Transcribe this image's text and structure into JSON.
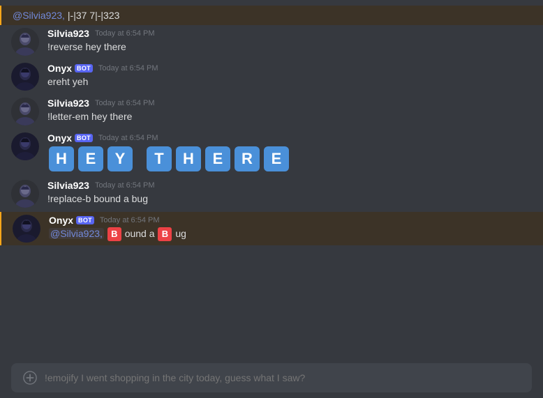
{
  "colors": {
    "background": "#36393f",
    "messageHover": "#32353b",
    "highlighted": "#3c3327",
    "highlightBorder": "#faa61a",
    "botBadge": "#5865f2",
    "mention": "#7289da",
    "letterBox": "#4a90d9",
    "highlightB": "#ed4245",
    "inputBg": "#40444b",
    "timestamp": "#72767d",
    "textColor": "#dcddde"
  },
  "topBar": {
    "mention": "@Silvia923,",
    "content": "|-|37 7|-|323"
  },
  "messages": [
    {
      "id": "msg1",
      "user": "Silvia923",
      "isBot": false,
      "timestamp": "Today at 6:54 PM",
      "text": "!reverse hey there"
    },
    {
      "id": "msg2",
      "user": "Onyx",
      "isBot": true,
      "timestamp": "Today at 6:54 PM",
      "text": "ereht yeh"
    },
    {
      "id": "msg3",
      "user": "Silvia923",
      "isBot": false,
      "timestamp": "Today at 6:54 PM",
      "text": "!letter-em hey there"
    },
    {
      "id": "msg4",
      "user": "Onyx",
      "isBot": true,
      "timestamp": "Today at 6:54 PM",
      "letters": [
        "H",
        "E",
        "Y",
        "T",
        "H",
        "E",
        "R",
        "E"
      ]
    },
    {
      "id": "msg5",
      "user": "Silvia923",
      "isBot": false,
      "timestamp": "Today at 6:54 PM",
      "text": "!replace-b bound a bug"
    },
    {
      "id": "msg6",
      "user": "Onyx",
      "isBot": true,
      "timestamp": "Today at 6:54 PM",
      "highlighted": true,
      "mentionPart": "@Silvia923,",
      "textParts": [
        " ",
        "ound a ",
        "ug"
      ],
      "bParts": 2
    }
  ],
  "inputBar": {
    "placeholder": "!emojify I went shopping in the city today, guess what I saw?",
    "addIcon": "plus-icon"
  },
  "botBadgeLabel": "BOT"
}
